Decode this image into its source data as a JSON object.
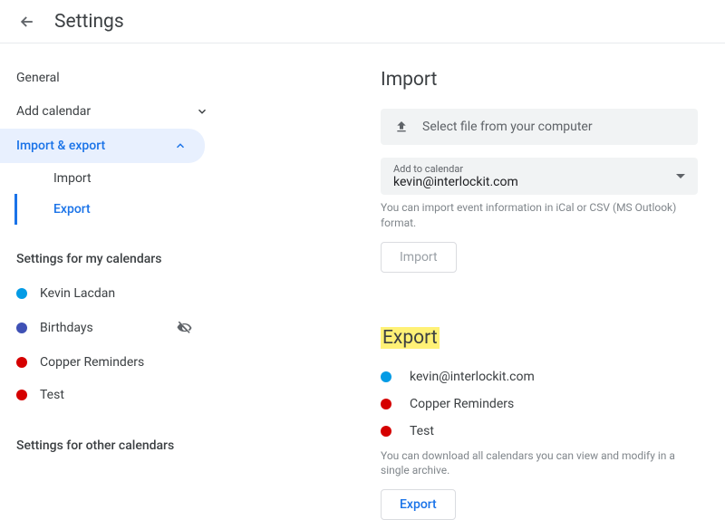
{
  "header": {
    "title": "Settings"
  },
  "sidebar": {
    "general": "General",
    "add_calendar": "Add calendar",
    "import_export": "Import & export",
    "sub_import": "Import",
    "sub_export": "Export",
    "my_calendars_header": "Settings for my calendars",
    "my_calendars": [
      {
        "label": "Kevin Lacdan",
        "color": "#039be5",
        "hidden": false
      },
      {
        "label": "Birthdays",
        "color": "#3f51b5",
        "hidden": true
      },
      {
        "label": "Copper Reminders",
        "color": "#d50000",
        "hidden": false
      },
      {
        "label": "Test",
        "color": "#d50000",
        "hidden": false
      }
    ],
    "other_calendars_header": "Settings for other calendars"
  },
  "import": {
    "title": "Import",
    "select_file": "Select file from your computer",
    "add_to_label": "Add to calendar",
    "add_to_value": "kevin@interlockit.com",
    "helper": "You can import event information in iCal or CSV (MS Outlook) format.",
    "button": "Import"
  },
  "export": {
    "title": "Export",
    "calendars": [
      {
        "label": "kevin@interlockit.com",
        "color": "#039be5"
      },
      {
        "label": "Copper Reminders",
        "color": "#d50000"
      },
      {
        "label": "Test",
        "color": "#d50000"
      }
    ],
    "helper": "You can download all calendars you can view and modify in a single archive.",
    "button": "Export"
  }
}
